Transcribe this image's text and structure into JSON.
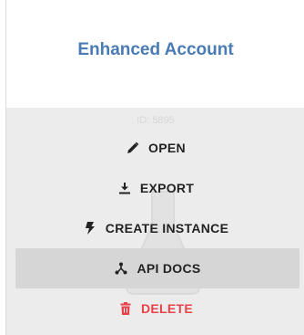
{
  "card": {
    "title": "Enhanced Account",
    "id_label": "ID: 5895"
  },
  "menu": {
    "items": [
      {
        "label": "OPEN",
        "icon": "pencil-icon"
      },
      {
        "label": "EXPORT",
        "icon": "download-icon"
      },
      {
        "label": "CREATE INSTANCE",
        "icon": "lightning-icon"
      },
      {
        "label": "API DOCS",
        "icon": "api-icon",
        "state": "hovered"
      },
      {
        "label": "DELETE",
        "icon": "trash-icon",
        "color": "#e8434b"
      }
    ]
  },
  "colors": {
    "title": "#4a7bb5",
    "overlay": "#ececec",
    "hover": "#d6d6d6",
    "danger": "#e8434b"
  }
}
